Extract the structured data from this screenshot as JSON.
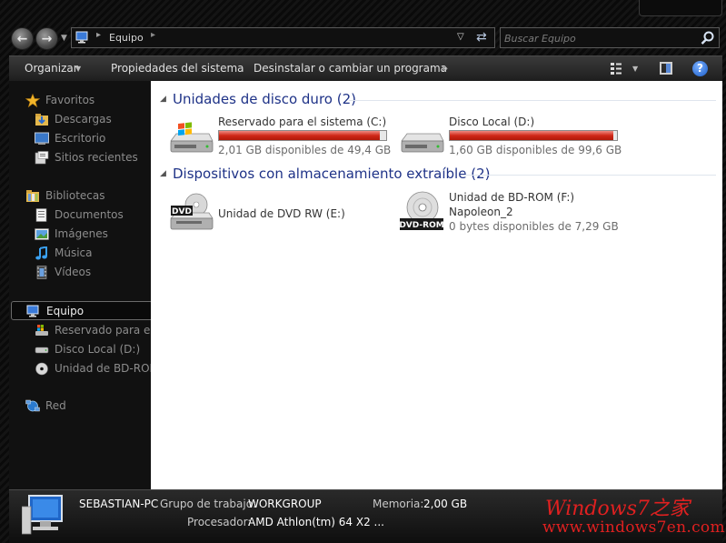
{
  "address": {
    "location": "Equipo",
    "search_placeholder": "Buscar Equipo"
  },
  "toolbar": {
    "organize": "Organizar",
    "system_properties": "Propiedades del sistema",
    "uninstall": "Desinstalar o cambiar un programa",
    "more": "»"
  },
  "nav": {
    "favorites": "Favoritos",
    "downloads": "Descargas",
    "desktop": "Escritorio",
    "recent": "Sitios recientes",
    "libraries": "Bibliotecas",
    "documents": "Documentos",
    "images": "Imágenes",
    "music": "Música",
    "videos": "Vídeos",
    "computer": "Equipo",
    "reserved": "Reservado para el sistema (C:)",
    "local_disk": "Disco Local (D:)",
    "bd_rom": "Unidad de BD-ROM (F:)",
    "network": "Red"
  },
  "groups": {
    "hard_drives": "Unidades de disco duro (2)",
    "removable": "Dispositivos con almacenamiento extraíble (2)"
  },
  "drives": {
    "c": {
      "name": "Reservado para el sistema (C:)",
      "free": "2,01 GB disponibles de 49,4 GB",
      "used_fraction": 0.96
    },
    "d": {
      "name": "Disco Local (D:)",
      "free": "1,60 GB disponibles de 99,6 GB",
      "used_fraction": 0.98
    },
    "e": {
      "name": "Unidad de DVD RW (E:)",
      "icon_label": "DVD"
    },
    "f": {
      "name": "Unidad de BD-ROM (F:)",
      "label": "Napoleon_2",
      "free": "0 bytes disponibles de 7,29 GB",
      "icon_label": "DVD-ROM"
    }
  },
  "details": {
    "computer_name": "SEBASTIAN-PC",
    "workgroup_label": "Grupo de trabajo:",
    "workgroup": "WORKGROUP",
    "memory_label": "Memoria:",
    "memory": "2,00 GB",
    "processor_label": "Procesador:",
    "processor": "AMD Athlon(tm) 64 X2 ..."
  },
  "watermark": {
    "logo": "Windows7之家",
    "url": "www.windows7en.com"
  },
  "colors": {
    "group_title": "#1e3287",
    "bar_fill": "#d02818",
    "watermark": "#e02020"
  }
}
